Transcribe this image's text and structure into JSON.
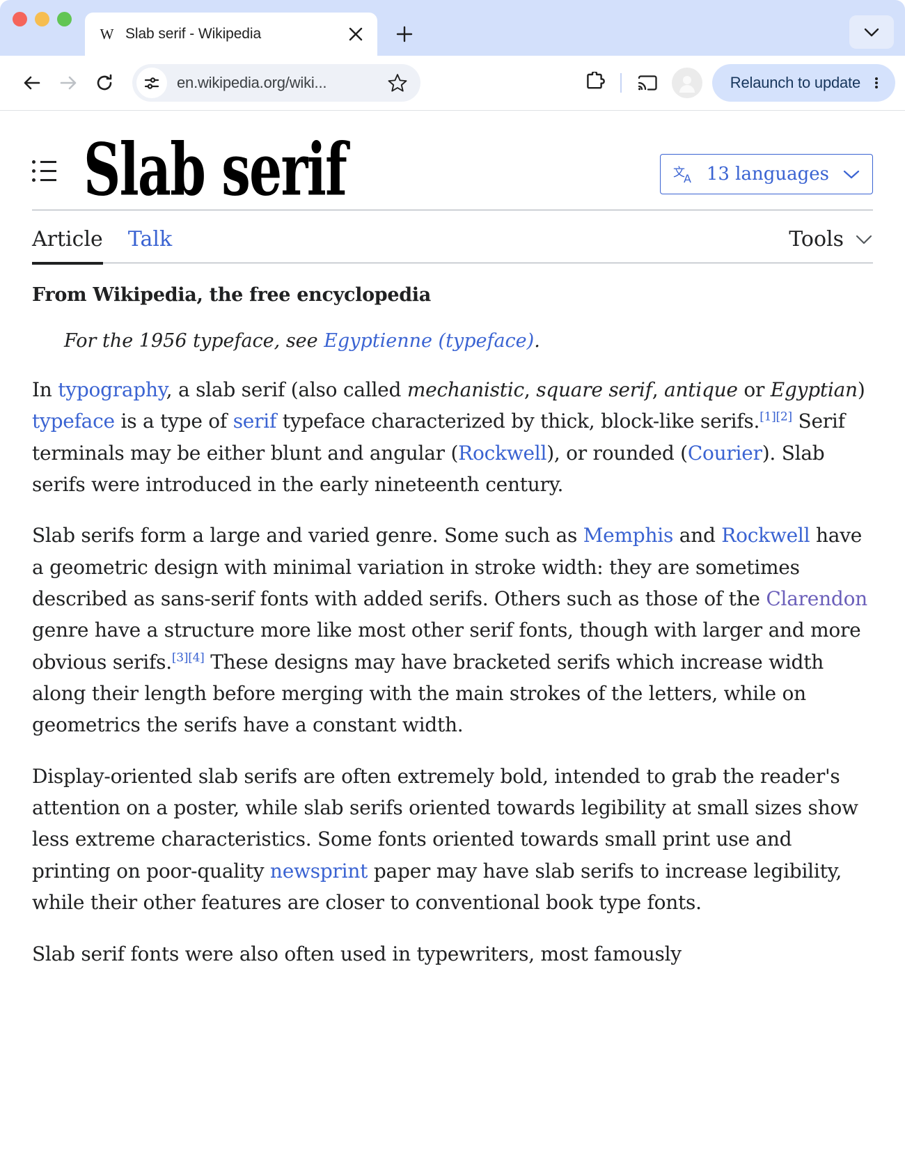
{
  "browser": {
    "tab": {
      "title": "Slab serif - Wikipedia",
      "favicon_glyph": "W",
      "close_glyph": "✕"
    },
    "new_tab_glyph": "+",
    "toolbar": {
      "back_label": "Back",
      "forward_label": "Forward",
      "reload_label": "Reload",
      "url": "en.wikipedia.org/wiki...",
      "bookmark_label": "Bookmark this tab",
      "extensions_label": "Extensions",
      "cast_label": "Cast",
      "profile_label": "Profile",
      "relaunch_label": "Relaunch to update",
      "menu_label": "Customize and control Chrome"
    }
  },
  "article": {
    "title": "Slab serif",
    "languages_button": {
      "icon": "language-icon",
      "label": "13 languages",
      "count": 13
    },
    "tabs": [
      {
        "label": "Article",
        "active": true
      },
      {
        "label": "Talk",
        "active": false
      }
    ],
    "tools": {
      "label": "Tools"
    },
    "site_sub": "From Wikipedia, the free encyclopedia",
    "hatnote": {
      "prefix": "For the 1956 typeface, see ",
      "link": "Egyptienne (typeface)",
      "suffix": "."
    },
    "paragraphs": [
      {
        "id": "p1",
        "parts": [
          {
            "t": "In "
          },
          {
            "t": "typography",
            "link": true
          },
          {
            "t": ", a slab serif (also called "
          },
          {
            "t": "mechanistic",
            "i": true
          },
          {
            "t": ", "
          },
          {
            "t": "square serif",
            "i": true
          },
          {
            "t": ", "
          },
          {
            "t": "antique",
            "i": true
          },
          {
            "t": " or "
          },
          {
            "t": "Egyptian",
            "i": true
          },
          {
            "t": ") "
          },
          {
            "t": "typeface",
            "link": true
          },
          {
            "t": " is a type of "
          },
          {
            "t": "serif",
            "link": true
          },
          {
            "t": " typeface characterized by thick, block-like serifs."
          },
          {
            "t": "[1]",
            "sup": true,
            "link": true
          },
          {
            "t": "[2]",
            "sup": true,
            "link": true
          },
          {
            "t": " Serif terminals may be either blunt and angular ("
          },
          {
            "t": "Rockwell",
            "link": true
          },
          {
            "t": "), or rounded ("
          },
          {
            "t": "Courier",
            "link": true
          },
          {
            "t": "). Slab serifs were introduced in the early nineteenth century."
          }
        ]
      },
      {
        "id": "p2",
        "parts": [
          {
            "t": "Slab serifs form a large and varied genre. Some such as "
          },
          {
            "t": "Memphis",
            "link": true
          },
          {
            "t": " and "
          },
          {
            "t": "Rockwell",
            "link": true
          },
          {
            "t": " have a geometric design with minimal variation in stroke width: they are sometimes described as sans-serif fonts with added serifs. Others such as those of the "
          },
          {
            "t": "Clarendon",
            "link": true,
            "visited": true
          },
          {
            "t": " genre have a structure more like most other serif fonts, though with larger and more obvious serifs."
          },
          {
            "t": "[3]",
            "sup": true,
            "link": true
          },
          {
            "t": "[4]",
            "sup": true,
            "link": true
          },
          {
            "t": " These designs may have bracketed serifs which increase width along their length before merging with the main strokes of the letters, while on geometrics the serifs have a constant width."
          }
        ]
      },
      {
        "id": "p3",
        "parts": [
          {
            "t": "Display-oriented slab serifs are often extremely bold, intended to grab the reader's attention on a poster, while slab serifs oriented towards legibility at small sizes show less extreme characteristics. Some fonts oriented towards small print use and printing on poor-quality "
          },
          {
            "t": "newsprint",
            "link": true
          },
          {
            "t": " paper may have slab serifs to increase legibility, while their other features are closer to conventional book type fonts."
          }
        ]
      },
      {
        "id": "p4",
        "parts": [
          {
            "t": "Slab serif fonts were also often used in typewriters, most famously"
          }
        ]
      }
    ]
  },
  "colors": {
    "link": "#3a63d2",
    "visited_link": "#6b5fba",
    "text": "#202122",
    "tab_strip": "#d3e0fb",
    "relaunch_pill": "#d5e2fc",
    "omnibox": "#eef1f7"
  }
}
